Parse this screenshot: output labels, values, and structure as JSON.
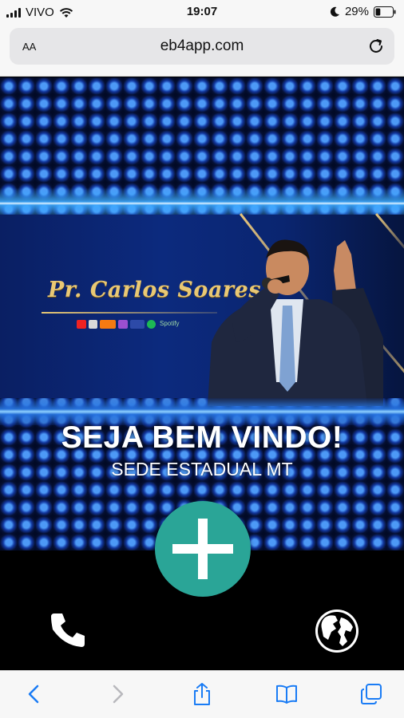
{
  "status_bar": {
    "carrier": "VIVO",
    "time": "19:07",
    "battery": "29%",
    "battery_level": 0.29
  },
  "browser": {
    "text_size_label": "AA",
    "url": "eb4app.com"
  },
  "banner": {
    "signature": "Pr. Carlos Soares",
    "spotify_label": "Spotify",
    "welcome": "SEJA BEM VINDO!",
    "subtitle": "SEDE ESTADUAL MT"
  },
  "actions": {
    "add_icon": "plus-icon",
    "phone_icon": "phone-icon",
    "globe_icon": "globe-icon"
  },
  "toolbar": {
    "icons": [
      "back-icon",
      "forward-icon",
      "share-icon",
      "bookmarks-icon",
      "tabs-icon"
    ]
  },
  "colors": {
    "accent_teal": "#2aa597",
    "ios_blue": "#1a7cf5",
    "gold": "#e9c874"
  }
}
